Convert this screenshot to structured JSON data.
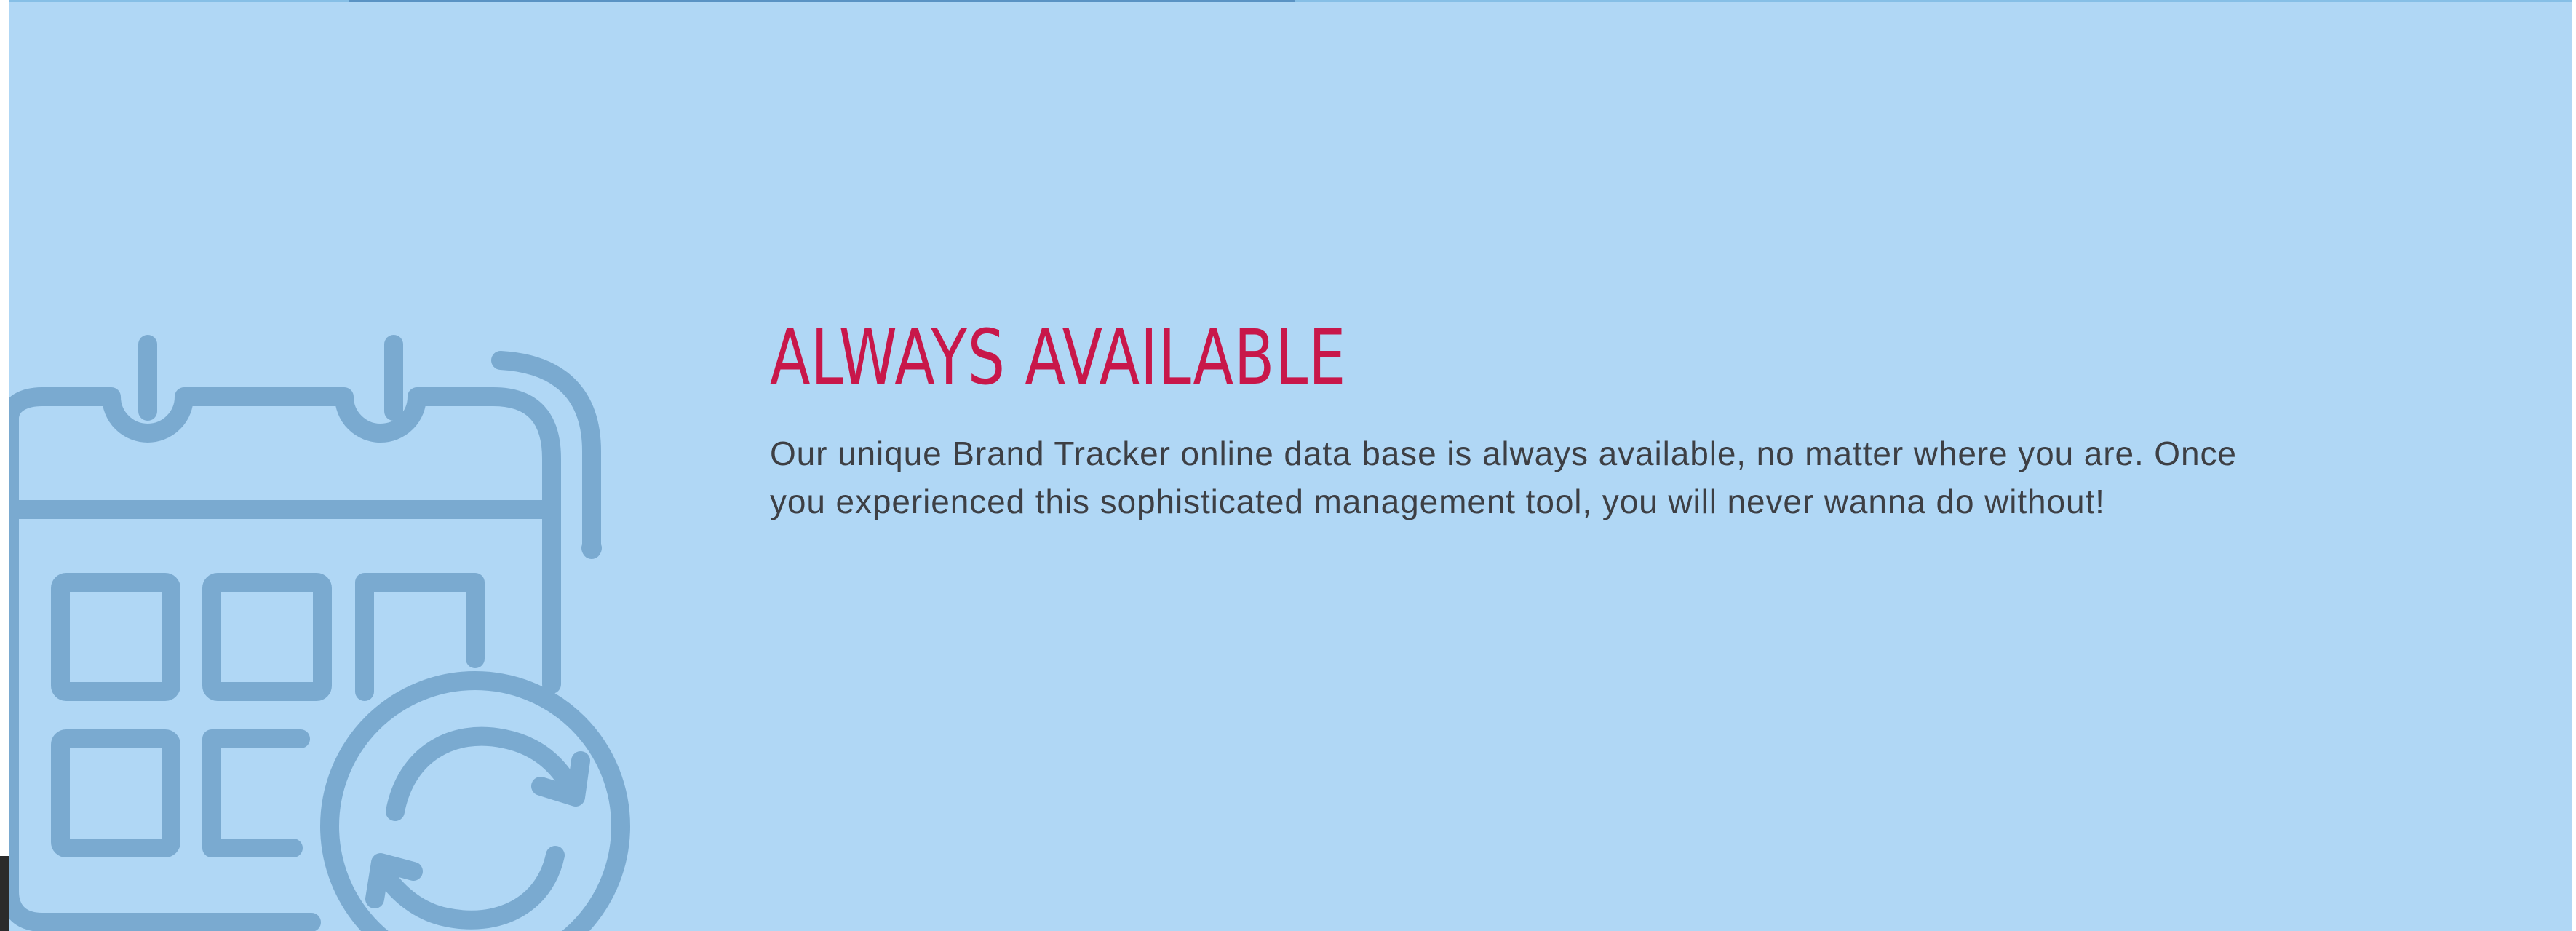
{
  "section": {
    "heading": "ALWAYS AVAILABLE",
    "body": "Our unique Brand Tracker online data base is always available, no matter where you are. Once you experienced this sophisticated management tool, you will never wanna do without!"
  },
  "icons": {
    "feature_icon": "calendar-sync-icon"
  },
  "colors": {
    "background": "#b0d7f5",
    "icon": "#7aaad0",
    "heading": "#c8174a",
    "body_text": "#3d3f44"
  }
}
